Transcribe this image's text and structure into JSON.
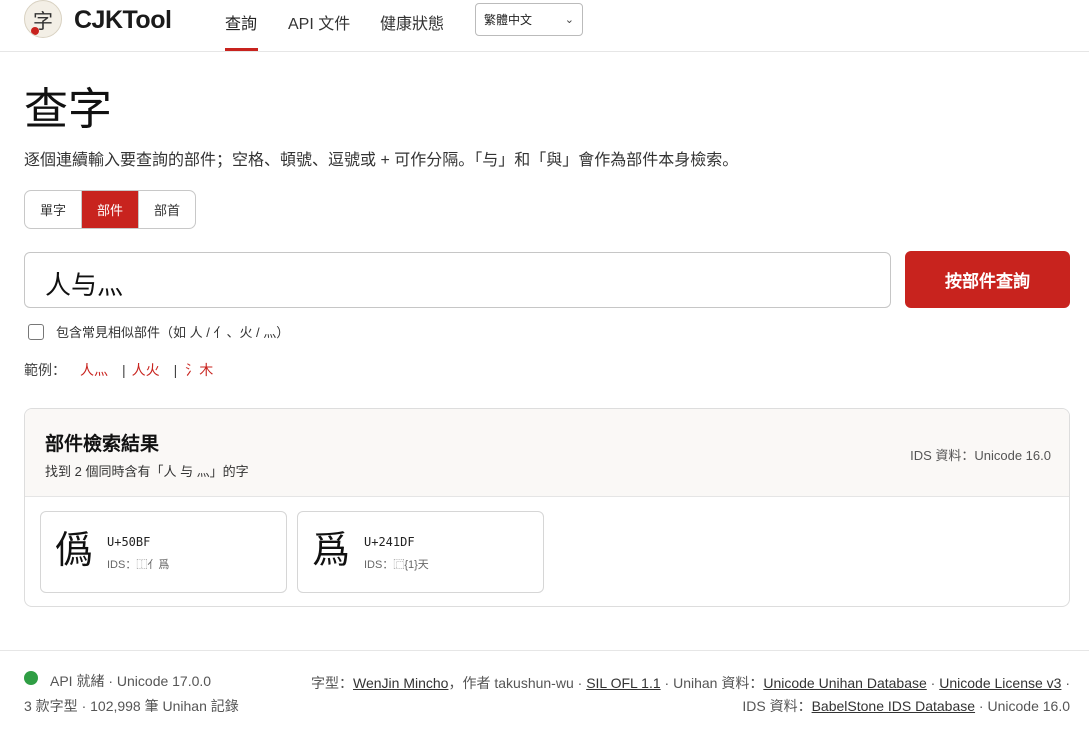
{
  "brand": {
    "logo_glyph": "字",
    "name": "CJKTool"
  },
  "nav": {
    "items": [
      {
        "label": "查詢"
      },
      {
        "label": "API 文件"
      },
      {
        "label": "健康狀態"
      }
    ],
    "language": "繁體中文"
  },
  "page": {
    "title": "查字",
    "description": "逐個連續輸入要查詢的部件；空格、頓號、逗號或 + 可作分隔。「与」和「與」會作為部件本身檢索。"
  },
  "modes": [
    "單字",
    "部件",
    "部首"
  ],
  "active_mode": "部件",
  "search": {
    "value": "人与灬",
    "button_label": "按部件查詢"
  },
  "similar_option": {
    "label": "包含常見相似部件（如 人 / 亻、火 / 灬）",
    "checked": false
  },
  "examples": {
    "label": "範例：",
    "items": [
      "人灬",
      "人火",
      "氵木"
    ],
    "separator": "|"
  },
  "results": {
    "title": "部件檢索結果",
    "summary": "找到 2 個同時含有「人 与 灬」的字",
    "ids_source": "IDS 資料：Unicode 16.0",
    "items": [
      {
        "char": "僞",
        "code": "U+50BF",
        "ids": "IDS：⿰亻爲"
      },
      {
        "char": "爲",
        "code": "U+241DF",
        "ids": "IDS：⿸{1}天"
      }
    ]
  },
  "footer": {
    "status": "API 就緒 · Unicode 17.0.0",
    "stats": "3 款字型 · 102,998 筆 Unihan 記錄",
    "line1": {
      "font_prefix": "字型：",
      "font_name": "WenJin Mincho",
      "author": "，作者 takushun-wu · ",
      "license": "SIL OFL 1.1",
      "unihan_prefix": " · Unihan 資料：",
      "unihan_db": "Unicode Unihan Database",
      "sep": " · ",
      "unicode_license": "Unicode License v3",
      "trail": " ·"
    },
    "line2": {
      "ids_prefix": "IDS 資料：",
      "ids_db": "BabelStone IDS Database",
      "ids_version": " · Unicode 16.0"
    }
  },
  "colors": {
    "accent": "#c8231e",
    "status_ok": "#2f9e44"
  }
}
